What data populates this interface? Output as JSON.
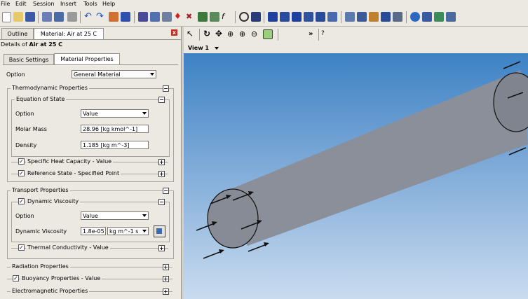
{
  "menu": [
    "File",
    "Edit",
    "Session",
    "Insert",
    "Tools",
    "Help"
  ],
  "tabs": {
    "outline": "Outline",
    "material": "Material: Air at 25 C"
  },
  "details": {
    "prefix": "Details of ",
    "name": "Air at 25 C"
  },
  "subtabs": {
    "basic": "Basic Settings",
    "material": "Material Properties"
  },
  "option": {
    "label": "Option",
    "value": "General Material"
  },
  "thermo": {
    "title": "Thermodynamic Properties",
    "eos": {
      "title": "Equation of State",
      "option_label": "Option",
      "option_value": "Value",
      "molar_label": "Molar Mass",
      "molar_value": "28.96 [kg kmol^-1]",
      "density_label": "Density",
      "density_value": "1.185 [kg m^-3]"
    },
    "specific_heat": "Specific Heat Capacity - Value",
    "reference_state": "Reference State - Specified Point"
  },
  "transport": {
    "title": "Transport Properties",
    "dyn_visc": {
      "title": "Dynamic Viscosity",
      "option_label": "Option",
      "option_value": "Value",
      "visc_label": "Dynamic Viscosity",
      "visc_value": "1.8e-05",
      "visc_unit": "kg m^-1 s"
    },
    "thermal": "Thermal Conductivity - Value"
  },
  "radiation": "Radiation Properties",
  "buoyancy": "Buoyancy Properties - Value",
  "electromagnetic": "Electromagnetic Properties",
  "viewer": {
    "label": "View 1"
  },
  "colors": {
    "bg_top": "#3d82c4",
    "bg_bottom": "#c9dcef",
    "cylinder": "#8a8f99"
  }
}
